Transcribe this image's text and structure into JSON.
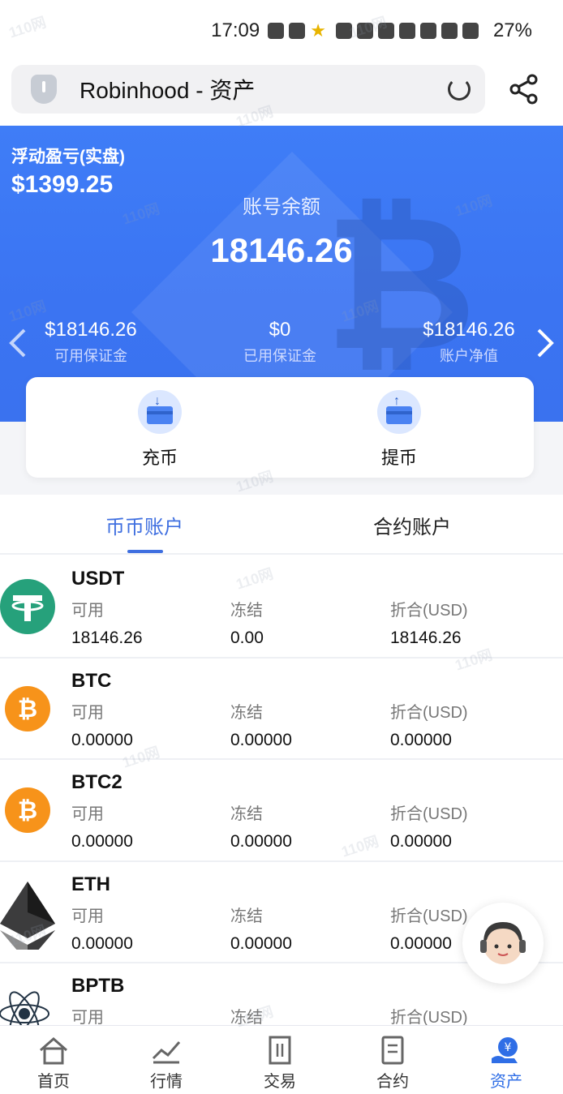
{
  "status_bar": {
    "time": "17:09",
    "battery": "27%"
  },
  "browser": {
    "title": "Robinhood - 资产"
  },
  "hero": {
    "float_pl_label": "浮动盈亏(实盘)",
    "float_pl_value": "$1399.25",
    "balance_label": "账号余额",
    "balance_value": "18146.26",
    "stats": [
      {
        "value": "$18146.26",
        "label": "可用保证金"
      },
      {
        "value": "$0",
        "label": "已用保证金"
      },
      {
        "value": "$18146.26",
        "label": "账户净值"
      }
    ]
  },
  "actions": {
    "deposit": "充币",
    "withdraw": "提币"
  },
  "tabs": {
    "spot": "币币账户",
    "contract": "合约账户"
  },
  "columns": {
    "available": "可用",
    "frozen": "冻结",
    "converted": "折合(USD)"
  },
  "assets": [
    {
      "symbol": "USDT",
      "available": "18146.26",
      "frozen": "0.00",
      "converted": "18146.26"
    },
    {
      "symbol": "BTC",
      "available": "0.00000",
      "frozen": "0.00000",
      "converted": "0.00000"
    },
    {
      "symbol": "BTC2",
      "available": "0.00000",
      "frozen": "0.00000",
      "converted": "0.00000"
    },
    {
      "symbol": "ETH",
      "available": "0.00000",
      "frozen": "0.00000",
      "converted": "0.00000"
    },
    {
      "symbol": "BPTB",
      "available": "",
      "frozen": "",
      "converted": ""
    }
  ],
  "bottom_nav": [
    {
      "label": "首页",
      "icon": "home-icon"
    },
    {
      "label": "行情",
      "icon": "market-icon"
    },
    {
      "label": "交易",
      "icon": "trade-icon"
    },
    {
      "label": "合约",
      "icon": "contract-icon"
    },
    {
      "label": "资产",
      "icon": "assets-icon"
    }
  ],
  "colors": {
    "primary": "#3f7df7",
    "active_tab": "#3f6fe0",
    "usdt": "#26a17b",
    "btc": "#f7931a"
  },
  "watermark": "110网"
}
